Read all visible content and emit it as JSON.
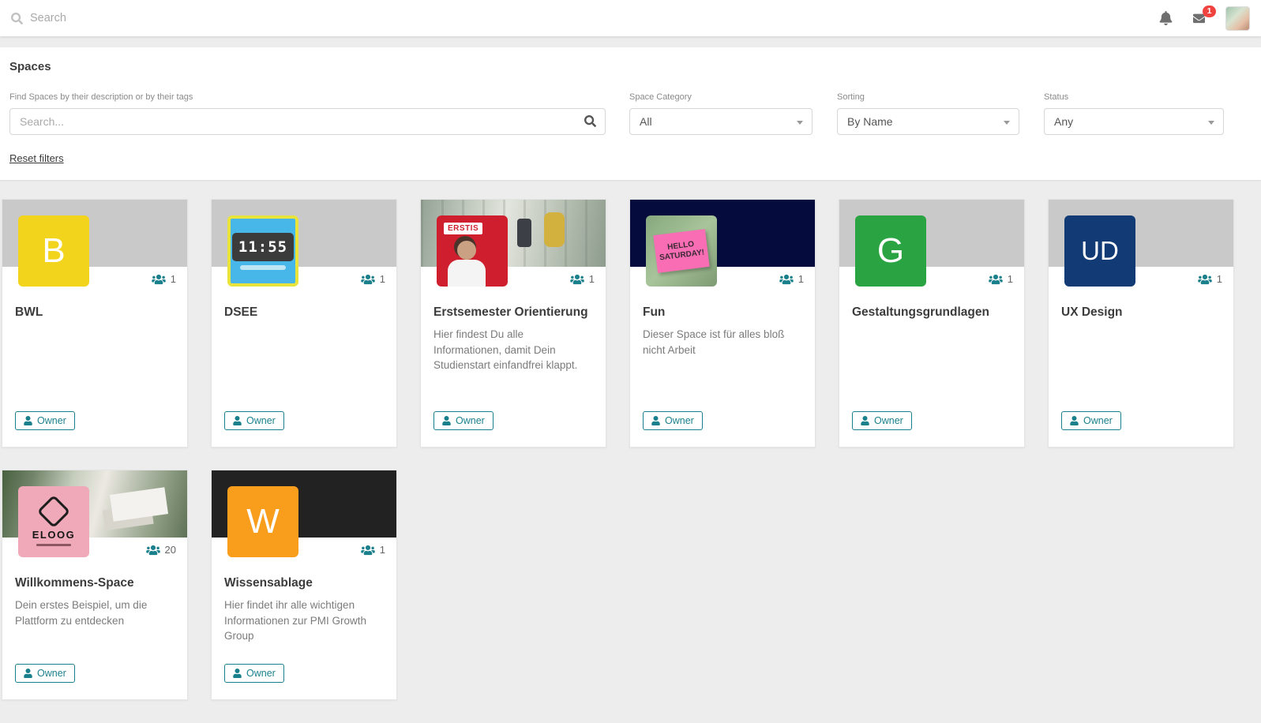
{
  "accent_color": "#1a808c",
  "badge_color": "#f0433f",
  "topbar": {
    "search_placeholder": "Search",
    "mail_badge": "1"
  },
  "filters": {
    "heading": "Spaces",
    "search_label": "Find Spaces by their description or by their tags",
    "search_placeholder": "Search...",
    "category_label": "Space Category",
    "category_value": "All",
    "sorting_label": "Sorting",
    "sorting_value": "By Name",
    "status_label": "Status",
    "status_value": "Any",
    "reset_label": "Reset filters"
  },
  "owner_label": "Owner",
  "spaces": [
    {
      "title": "BWL",
      "description": "",
      "members": "1",
      "avatar_text": "B",
      "avatar_bg": "#f3d41c"
    },
    {
      "title": "DSEE",
      "description": "",
      "members": "1",
      "avatar_text": "11:55"
    },
    {
      "title": "Erstsemester Orientierung",
      "description": "Hier findest Du alle Informationen, damit Dein Studienstart einfandfrei klappt.",
      "members": "1",
      "avatar_text": "ERSTIS"
    },
    {
      "title": "Fun",
      "description": "Dieser Space ist für alles bloß nicht Arbeit",
      "members": "1",
      "avatar_text": "HELLO SATURDAY!",
      "banner_bg": "#060b3e"
    },
    {
      "title": "Gestaltungsgrundlagen",
      "description": "",
      "members": "1",
      "avatar_text": "G",
      "avatar_bg": "#2aa343"
    },
    {
      "title": "UX Design",
      "description": "",
      "members": "1",
      "avatar_text": "UD",
      "avatar_bg": "#123a75"
    },
    {
      "title": "Willkommens-Space",
      "description": "Dein erstes Beispiel, um die Plattform zu entdecken",
      "members": "20",
      "avatar_text": "ELOOG"
    },
    {
      "title": "Wissensablage",
      "description": "Hier findet ihr alle wichtigen Informationen zur PMI Growth Group",
      "members": "1",
      "avatar_text": "W",
      "avatar_bg": "#f99d1c",
      "banner_bg": "#222222"
    }
  ]
}
